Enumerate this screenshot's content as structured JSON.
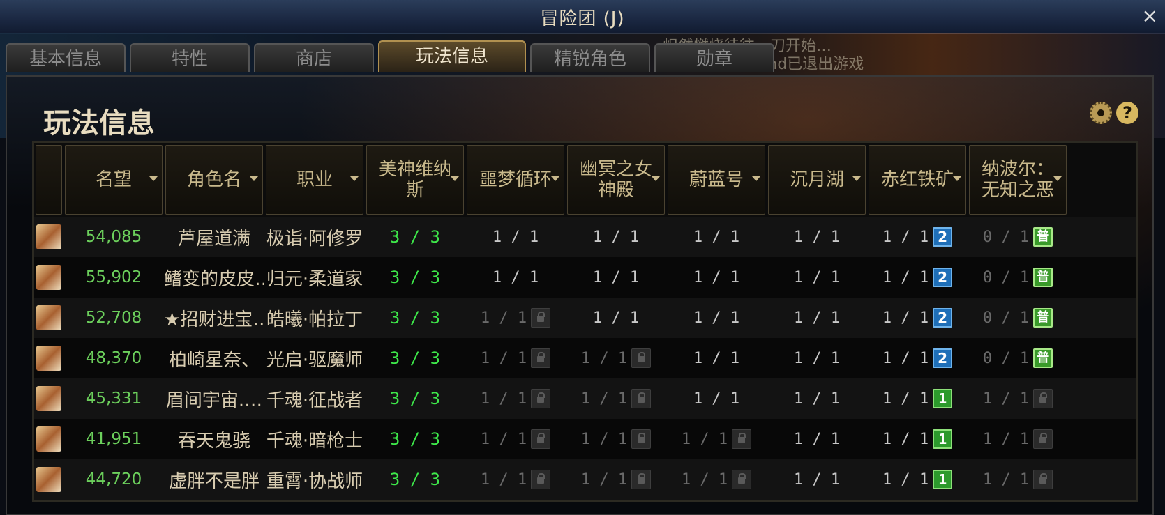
{
  "window": {
    "title": "冒险团 (J)",
    "close": "×"
  },
  "overlay": {
    "line1": "炽然燃烧待往…刀开始…",
    "line2": "akeRind已退出游戏"
  },
  "tabs": [
    {
      "label": "基本信息"
    },
    {
      "label": "特性"
    },
    {
      "label": "商店"
    },
    {
      "label": "玩法信息",
      "active": true
    },
    {
      "label": "精锐角色"
    },
    {
      "label": "勋章"
    }
  ],
  "panel": {
    "title": "玩法信息",
    "help": "?"
  },
  "columns": [
    {
      "label": ""
    },
    {
      "label": "名望"
    },
    {
      "label": "角色名"
    },
    {
      "label": "职业"
    },
    {
      "label": "美神维纳斯"
    },
    {
      "label": "噩梦循环"
    },
    {
      "label": "幽冥之女神殿"
    },
    {
      "label": "蔚蓝号"
    },
    {
      "label": "沉月湖"
    },
    {
      "label": "赤红铁矿"
    },
    {
      "label": "纳波尔：无知之恶"
    }
  ],
  "rows": [
    {
      "fame": "54,085",
      "name": "芦屋道满",
      "job": "极诣·阿修罗",
      "venus": "3 / 3",
      "nightmare": "1 / 1",
      "nightmare_locked": false,
      "goddess": "1 / 1",
      "goddess_locked": false,
      "azure": "1 / 1",
      "azure_locked": false,
      "moonlake": "1 / 1",
      "redmine": "1 / 1",
      "redmine_badge": "2",
      "napol": "0 / 1",
      "napol_badge": "普",
      "napol_locked": false
    },
    {
      "fame": "55,902",
      "name": "鳍变的皮皮…",
      "job": "归元·柔道家",
      "venus": "3 / 3",
      "nightmare": "1 / 1",
      "nightmare_locked": false,
      "goddess": "1 / 1",
      "goddess_locked": false,
      "azure": "1 / 1",
      "azure_locked": false,
      "moonlake": "1 / 1",
      "redmine": "1 / 1",
      "redmine_badge": "2",
      "napol": "0 / 1",
      "napol_badge": "普",
      "napol_locked": false
    },
    {
      "fame": "52,708",
      "name": "★招财进宝…",
      "job": "皓曦·帕拉丁",
      "venus": "3 / 3",
      "nightmare": "1 / 1",
      "nightmare_locked": true,
      "goddess": "1 / 1",
      "goddess_locked": false,
      "azure": "1 / 1",
      "azure_locked": false,
      "moonlake": "1 / 1",
      "redmine": "1 / 1",
      "redmine_badge": "2",
      "napol": "0 / 1",
      "napol_badge": "普",
      "napol_locked": false
    },
    {
      "fame": "48,370",
      "name": "柏崎星奈、",
      "job": "光启·驱魔师",
      "venus": "3 / 3",
      "nightmare": "1 / 1",
      "nightmare_locked": true,
      "goddess": "1 / 1",
      "goddess_locked": true,
      "azure": "1 / 1",
      "azure_locked": false,
      "moonlake": "1 / 1",
      "redmine": "1 / 1",
      "redmine_badge": "2",
      "napol": "0 / 1",
      "napol_badge": "普",
      "napol_locked": false
    },
    {
      "fame": "45,331",
      "name": "眉间宇宙.…",
      "job": "千魂·征战者",
      "venus": "3 / 3",
      "nightmare": "1 / 1",
      "nightmare_locked": true,
      "goddess": "1 / 1",
      "goddess_locked": true,
      "azure": "1 / 1",
      "azure_locked": false,
      "moonlake": "1 / 1",
      "redmine": "1 / 1",
      "redmine_badge": "1",
      "napol": "1 / 1",
      "napol_badge": "",
      "napol_locked": true
    },
    {
      "fame": "41,951",
      "name": "吞天鬼骁",
      "job": "千魂·暗枪士",
      "venus": "3 / 3",
      "nightmare": "1 / 1",
      "nightmare_locked": true,
      "goddess": "1 / 1",
      "goddess_locked": true,
      "azure": "1 / 1",
      "azure_locked": true,
      "moonlake": "1 / 1",
      "redmine": "1 / 1",
      "redmine_badge": "1",
      "napol": "1 / 1",
      "napol_badge": "",
      "napol_locked": true
    },
    {
      "fame": "44,720",
      "name": "虚胖不是胖",
      "job": "重霄·协战师",
      "venus": "3 / 3",
      "nightmare": "1 / 1",
      "nightmare_locked": true,
      "goddess": "1 / 1",
      "goddess_locked": true,
      "azure": "1 / 1",
      "azure_locked": true,
      "moonlake": "1 / 1",
      "redmine": "1 / 1",
      "redmine_badge": "1",
      "napol": "1 / 1",
      "napol_badge": "",
      "napol_locked": true
    }
  ]
}
